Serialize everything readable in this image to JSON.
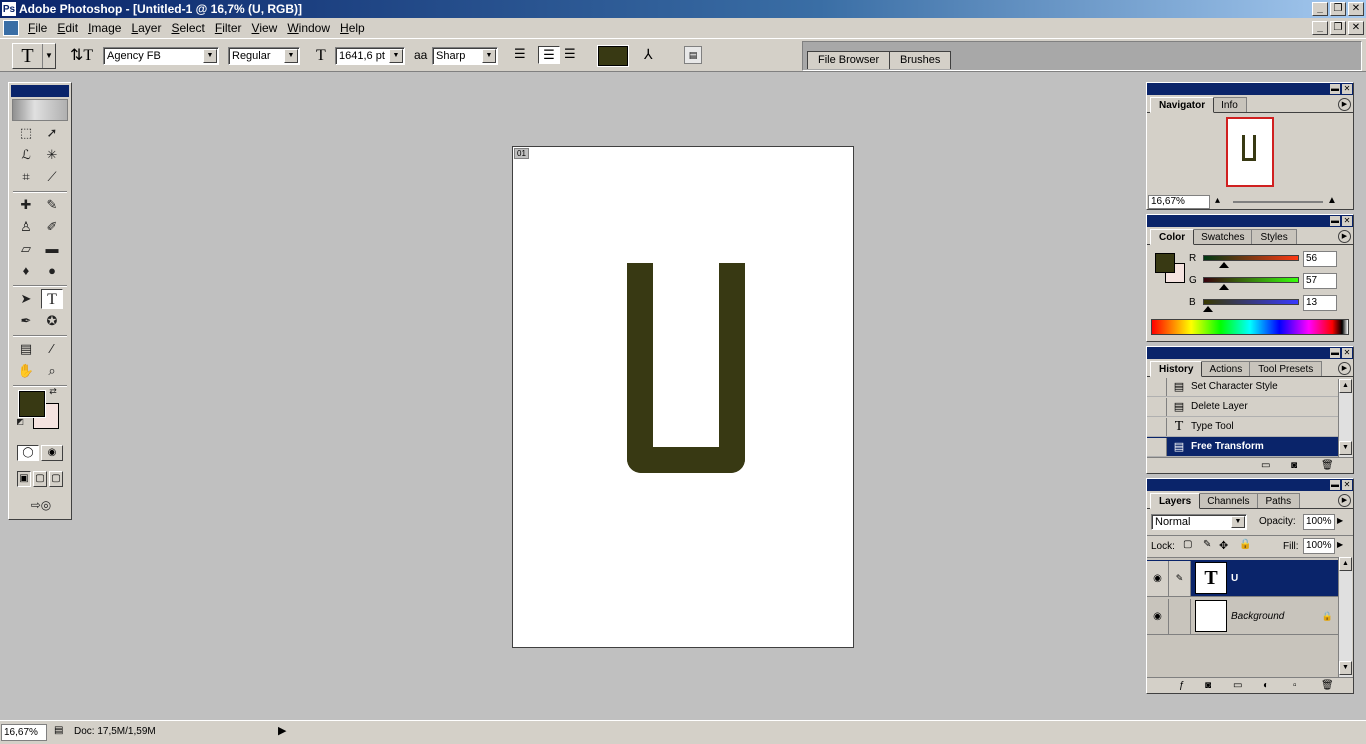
{
  "window": {
    "title": "Adobe Photoshop - [Untitled-1 @ 16,7% (U, RGB)]",
    "app_icon": "photoshop-icon",
    "controls": [
      "_",
      "❐",
      "✕"
    ]
  },
  "menu": [
    "File",
    "Edit",
    "Image",
    "Layer",
    "Select",
    "Filter",
    "View",
    "Window",
    "Help"
  ],
  "options_bar": {
    "font_family": "Agency FB",
    "font_style": "Regular",
    "font_size": "1641,6 pt",
    "antialias_label": "aa",
    "antialias": "Sharp",
    "text_color": "#383913"
  },
  "palette_well": {
    "tabs": [
      "File Browser",
      "Brushes"
    ]
  },
  "document": {
    "corner_label": "01",
    "text": "U",
    "text_color": "#383913"
  },
  "navigator_panel": {
    "tabs": [
      "Navigator",
      "Info"
    ],
    "zoom": "16,67%"
  },
  "color_panel": {
    "tabs": [
      "Color",
      "Swatches",
      "Styles"
    ],
    "channels": [
      {
        "label": "R",
        "value": "56"
      },
      {
        "label": "G",
        "value": "57"
      },
      {
        "label": "B",
        "value": "13"
      }
    ],
    "foreground": "#383913",
    "background": "#f5e3e0"
  },
  "history_panel": {
    "tabs": [
      "History",
      "Actions",
      "Tool Presets"
    ],
    "items": [
      {
        "label": "Set Character Style",
        "icon": "history-doc-icon"
      },
      {
        "label": "Delete Layer",
        "icon": "history-doc-icon"
      },
      {
        "label": "Type Tool",
        "icon": "type-tool-icon"
      },
      {
        "label": "Free Transform",
        "icon": "history-doc-icon",
        "selected": true
      }
    ]
  },
  "layers_panel": {
    "tabs": [
      "Layers",
      "Channels",
      "Paths"
    ],
    "blend_mode": "Normal",
    "opacity_label": "Opacity:",
    "opacity": "100%",
    "lock_label": "Lock:",
    "fill_label": "Fill:",
    "fill": "100%",
    "layers": [
      {
        "name": "U",
        "thumb": "T",
        "selected": true
      },
      {
        "name": "Background",
        "thumb": "",
        "locked": true
      }
    ]
  },
  "statusbar": {
    "zoom": "16,67%",
    "doc_info": "Doc: 17,5M/1,59M"
  }
}
